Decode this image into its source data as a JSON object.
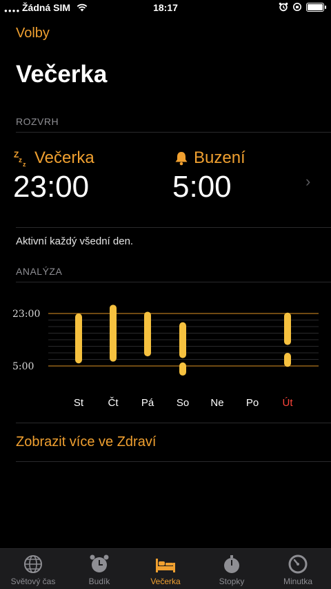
{
  "status": {
    "carrier": "Žádná SIM",
    "time": "18:17"
  },
  "header": {
    "options": "Volby",
    "title": "Večerka"
  },
  "schedule": {
    "heading": "ROZVRH",
    "bedtime": {
      "label": "Večerka",
      "time": "23:00"
    },
    "wake": {
      "label": "Buzení",
      "time": "5:00"
    },
    "note": "Aktivní každý všední den."
  },
  "analysis": {
    "heading": "ANALÝZA",
    "y_labels": [
      "23:00",
      "5:00"
    ],
    "days": [
      "St",
      "Čt",
      "Pá",
      "So",
      "Ne",
      "Po",
      "Út"
    ],
    "today_color": "#ff453a",
    "accent": "#f0a030",
    "bar_color": "#f6c13f",
    "link": "Zobrazit více ve Zdraví"
  },
  "chart_data": {
    "type": "bar",
    "categories": [
      "St",
      "Čt",
      "Pá",
      "So",
      "Ne",
      "Po",
      "Út"
    ],
    "y_ticks": [
      "23:00",
      "5:00"
    ],
    "ylim_hours_after_target_bedtime": [
      0,
      6
    ],
    "segments": [
      [
        {
          "start": 0.0,
          "end": 5.7
        }
      ],
      [
        {
          "start": -1.0,
          "end": 5.5
        }
      ],
      [
        {
          "start": -0.2,
          "end": 4.9
        }
      ],
      [
        {
          "start": 1.0,
          "end": 5.1
        },
        {
          "start": 5.6,
          "end": 7.1
        }
      ],
      [],
      [],
      [
        {
          "start": -0.1,
          "end": 3.6
        },
        {
          "start": 4.5,
          "end": 6.1
        }
      ]
    ]
  },
  "tabs": [
    {
      "label": "Světový čas",
      "icon": "globe-icon"
    },
    {
      "label": "Budík",
      "icon": "alarm-clock-icon"
    },
    {
      "label": "Večerka",
      "icon": "bed-icon",
      "active": true
    },
    {
      "label": "Stopky",
      "icon": "stopwatch-icon"
    },
    {
      "label": "Minutka",
      "icon": "timer-icon"
    }
  ]
}
